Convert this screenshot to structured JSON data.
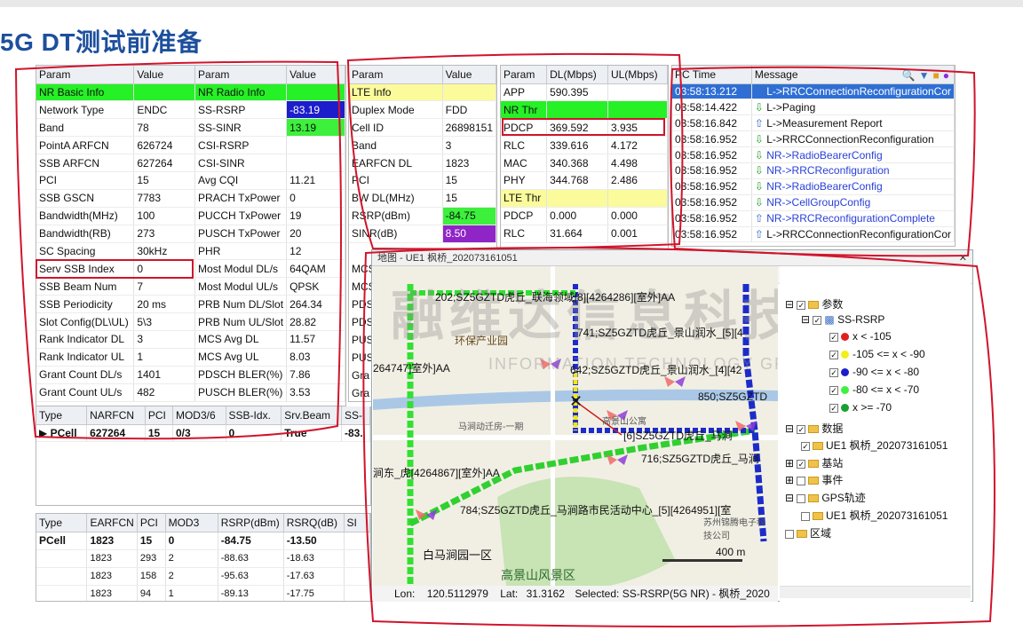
{
  "title": "5G DT测试前准备",
  "nr_table": {
    "headers": [
      "Param",
      "Value",
      "Param",
      "Value"
    ],
    "rows": [
      [
        "NR Basic Info",
        "",
        "NR Radio Info",
        ""
      ],
      [
        "Network Type",
        "ENDC",
        "SS-RSRP",
        "-83.19"
      ],
      [
        "Band",
        "78",
        "SS-SINR",
        "13.19"
      ],
      [
        "PointA ARFCN",
        "626724",
        "CSI-RSRP",
        ""
      ],
      [
        "SSB ARFCN",
        "627264",
        "CSI-SINR",
        ""
      ],
      [
        "PCI",
        "15",
        "Avg CQI",
        "11.21"
      ],
      [
        "SSB GSCN",
        "7783",
        "PRACH TxPower",
        "0"
      ],
      [
        "Bandwidth(MHz)",
        "100",
        "PUCCH TxPower",
        "19"
      ],
      [
        "Bandwidth(RB)",
        "273",
        "PUSCH TxPower",
        "20"
      ],
      [
        "SC Spacing",
        "30kHz",
        "PHR",
        "12"
      ],
      [
        "Serv SSB Index",
        "0",
        "Most Modul DL/s",
        "64QAM"
      ],
      [
        "SSB Beam Num",
        "7",
        "Most Modul UL/s",
        "QPSK"
      ],
      [
        "SSB Periodicity",
        "20 ms",
        "PRB Num DL/Slot",
        "264.34"
      ],
      [
        "Slot Config(DL\\UL)",
        "5\\3",
        "PRB Num UL/Slot",
        "28.82"
      ],
      [
        "Rank Indicator DL",
        "3",
        "MCS Avg DL",
        "11.57"
      ],
      [
        "Rank Indicator UL",
        "1",
        "MCS Avg UL",
        "8.03"
      ],
      [
        "Grant Count DL/s",
        "1401",
        "PDSCH BLER(%)",
        "7.86"
      ],
      [
        "Grant Count UL/s",
        "482",
        "PUSCH BLER(%)",
        "3.53"
      ]
    ]
  },
  "cell_table": {
    "headers": [
      "Type",
      "NARFCN",
      "PCI",
      "MOD3/6",
      "SSB-Idx.",
      "Srv.Beam",
      "SS-"
    ],
    "rows": [
      [
        "PCell",
        "627264",
        "15",
        "0/3",
        "0",
        "True",
        "-83."
      ]
    ]
  },
  "lte_table": {
    "headers": [
      "Param",
      "Value"
    ],
    "rows": [
      [
        "LTE Info",
        ""
      ],
      [
        "Duplex Mode",
        "FDD"
      ],
      [
        "Cell ID",
        "26898151"
      ],
      [
        "Band",
        "3"
      ],
      [
        "EARFCN DL",
        "1823"
      ],
      [
        "PCI",
        "15"
      ],
      [
        "BW DL(MHz)",
        "15"
      ],
      [
        "RSRP(dBm)",
        "-84.75"
      ],
      [
        "SINR(dB)",
        "8.50"
      ]
    ]
  },
  "lte_side_labels": [
    "MCS",
    "MCS",
    "PDS",
    "PDS",
    "PUS",
    "PUS",
    "Gra",
    "Gra"
  ],
  "thr_table": {
    "headers": [
      "Param",
      "DL(Mbps)",
      "UL(Mbps)"
    ],
    "rows": [
      [
        "APP",
        "590.395",
        ""
      ],
      [
        "NR Thr",
        "",
        ""
      ],
      [
        "PDCP",
        "369.592",
        "3.935"
      ],
      [
        "RLC",
        "339.616",
        "4.172"
      ],
      [
        "MAC",
        "340.368",
        "4.498"
      ],
      [
        "PHY",
        "344.768",
        "2.486"
      ],
      [
        "LTE Thr",
        "",
        ""
      ],
      [
        "PDCP",
        "0.000",
        "0.000"
      ],
      [
        "RLC",
        "31.664",
        "0.001"
      ]
    ]
  },
  "msg_table": {
    "headers": [
      "PC Time",
      "Message"
    ],
    "rows": [
      [
        "03:58:13.212",
        "L->RRCConnectionReconfigurationCor",
        "up"
      ],
      [
        "03:58:14.422",
        "L->Paging",
        "down"
      ],
      [
        "03:58:16.842",
        "L->Measurement Report",
        "up"
      ],
      [
        "03:58:16.952",
        "L->RRCConnectionReconfiguration",
        "down"
      ],
      [
        "03:58:16.952",
        "NR->RadioBearerConfig",
        "down"
      ],
      [
        "03:58:16.952",
        "NR->RRCReconfiguration",
        "down"
      ],
      [
        "03:58:16.952",
        "NR->RadioBearerConfig",
        "down"
      ],
      [
        "03:58:16.952",
        "NR->CellGroupConfig",
        "down"
      ],
      [
        "03:58:16.952",
        "NR->RRCReconfigurationComplete",
        "up"
      ],
      [
        "03:58:16.952",
        "L->RRCConnectionReconfigurationCor",
        "up"
      ]
    ]
  },
  "lte_cells": {
    "headers": [
      "Type",
      "EARFCN",
      "PCI",
      "MOD3",
      "RSRP(dBm)",
      "RSRQ(dB)",
      "SI"
    ],
    "rows": [
      [
        "PCell",
        "1823",
        "15",
        "0",
        "-84.75",
        "-13.50",
        ""
      ],
      [
        "",
        "1823",
        "293",
        "2",
        "-88.63",
        "-18.63",
        ""
      ],
      [
        "",
        "1823",
        "158",
        "2",
        "-95.63",
        "-17.63",
        ""
      ],
      [
        "",
        "1823",
        "94",
        "1",
        "-89.13",
        "-17.75",
        ""
      ]
    ]
  },
  "map": {
    "window_title": "地图 - UE1 枫桥_202073161051",
    "labels": {
      "top_cell": "202;SZ5GZTD虎丘_联海领域[8][4264286][室外]AA",
      "district": "环保产业园",
      "cell_741": "741;SZ5GZTD虎丘_景山润水_[5][4",
      "cell_642": "642;SZ5GZTD虎丘_景山润水_[4][42",
      "cell_264": "264747]室外]AA",
      "cell_850": "850;SZ5GZTD",
      "cell_mid": "[6]SZ5GZTD虎丘_马涧",
      "cell_716": "716;SZ5GZTD虎丘_马涧",
      "cell_left": "涧东_虎[4264867][室外]AA",
      "cell_784": "784;SZ5GZTD虎丘_马涧路市民活动中心_[5][4264951][室",
      "poi1": "白马涧园一区",
      "poi2": "高景山风景区",
      "poi3": "高景山公寓",
      "poi4": "马涧动迁房-一期",
      "poi5": "苏州锦腾电子科技公司",
      "scale": "400 m",
      "watermark": "融维达信息科技",
      "watermark_en": "INFORMATION TECHNOLOGY GROUP"
    },
    "status": {
      "lon_label": "Lon:",
      "lon": "120.5112979",
      "lat_label": "Lat:",
      "lat": "31.3162",
      "selected": "Selected: SS-RSRP(5G NR) - 枫桥_2020"
    }
  },
  "tree": {
    "root": "参数",
    "metric": "SS-RSRP",
    "legend": [
      {
        "label": "x < -105",
        "color": "#e02020"
      },
      {
        "label": "-105 <= x < -90",
        "color": "#f2ee16"
      },
      {
        "label": "-90 <= x < -80",
        "color": "#1c1ccc"
      },
      {
        "label": "-80 <= x < -70",
        "color": "#40f040"
      },
      {
        "label": "x >= -70",
        "color": "#18a030"
      }
    ],
    "data": "数据",
    "ue": "UE1 枫桥_202073161051",
    "station": "基站",
    "event": "事件",
    "gps": "GPS轨迹",
    "gps_ue": "UE1 枫桥_202073161051",
    "area": "区域"
  }
}
